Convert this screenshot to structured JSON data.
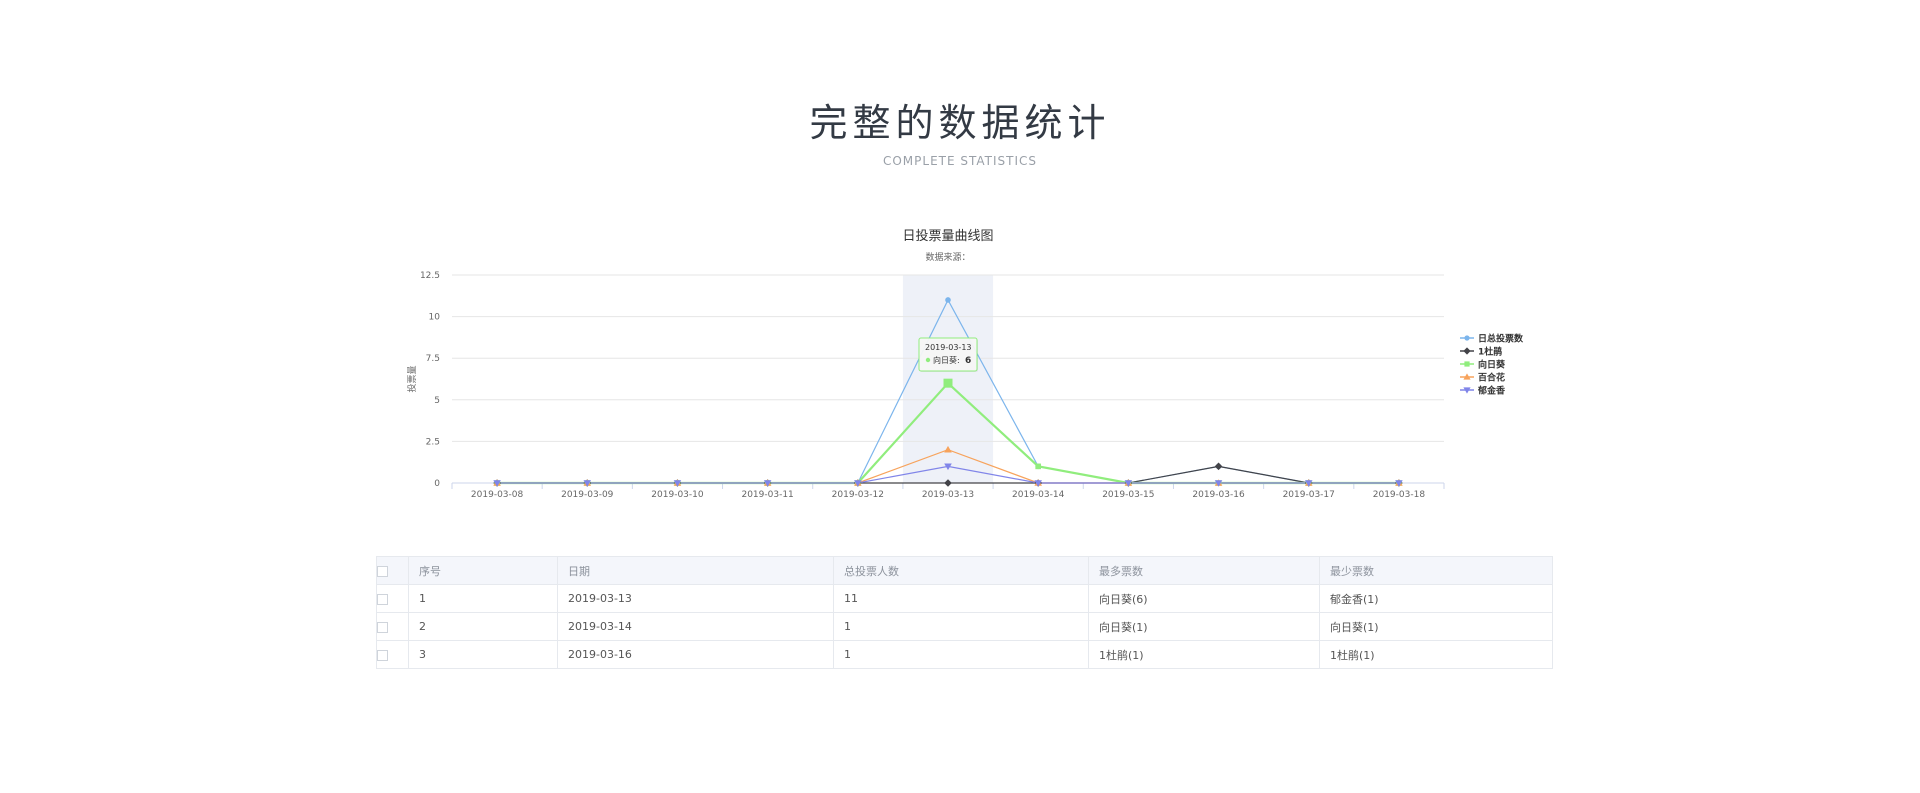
{
  "header": {
    "title": "完整的数据统计",
    "subtitle": "COMPLETE STATISTICS"
  },
  "colors": {
    "total": "#7cb5ec",
    "dujuan": "#434348",
    "xiangrikui": "#90ed7d",
    "baihehua": "#f7a35c",
    "yujinxiang": "#8085e9",
    "highlight": "#eef1f8"
  },
  "chart_data": {
    "type": "line",
    "title": "日投票量曲线图",
    "subtitle": "数据来源：",
    "ylabel": "投票量",
    "xlabel": "",
    "categories": [
      "2019-03-08",
      "2019-03-09",
      "2019-03-10",
      "2019-03-11",
      "2019-03-12",
      "2019-03-13",
      "2019-03-14",
      "2019-03-15",
      "2019-03-16",
      "2019-03-17",
      "2019-03-18"
    ],
    "ylim": [
      0,
      12.5
    ],
    "yticks": [
      "0",
      "2.5",
      "5",
      "7.5",
      "10",
      "12.5"
    ],
    "grid": true,
    "legend_position": "right",
    "series": [
      {
        "name": "日总投票数",
        "color": "#7cb5ec",
        "marker": "circle",
        "values": [
          0,
          0,
          0,
          0,
          0,
          11,
          1,
          0,
          1,
          0,
          0
        ]
      },
      {
        "name": "1杜鹃",
        "color": "#434348",
        "marker": "diamond",
        "values": [
          0,
          0,
          0,
          0,
          0,
          0,
          0,
          0,
          1,
          0,
          0
        ]
      },
      {
        "name": "向日葵",
        "color": "#90ed7d",
        "marker": "square",
        "values": [
          0,
          0,
          0,
          0,
          0,
          6,
          1,
          0,
          0,
          0,
          0
        ]
      },
      {
        "name": "百合花",
        "color": "#f7a35c",
        "marker": "triangle",
        "values": [
          0,
          0,
          0,
          0,
          0,
          2,
          0,
          0,
          0,
          0,
          0
        ]
      },
      {
        "name": "郁金香",
        "color": "#8085e9",
        "marker": "triangle-down",
        "values": [
          0,
          0,
          0,
          0,
          0,
          1,
          0,
          0,
          0,
          0,
          0
        ]
      }
    ],
    "hovered_index": 5,
    "tooltip": {
      "date": "2019-03-13",
      "series": "向日葵",
      "value": "6"
    }
  },
  "table": {
    "headers": [
      "序号",
      "日期",
      "总投票人数",
      "最多票数",
      "最少票数"
    ],
    "rows": [
      [
        "1",
        "2019-03-13",
        "11",
        "向日葵(6)",
        "郁金香(1)"
      ],
      [
        "2",
        "2019-03-14",
        "1",
        "向日葵(1)",
        "向日葵(1)"
      ],
      [
        "3",
        "2019-03-16",
        "1",
        "1杜鹃(1)",
        "1杜鹃(1)"
      ]
    ]
  }
}
